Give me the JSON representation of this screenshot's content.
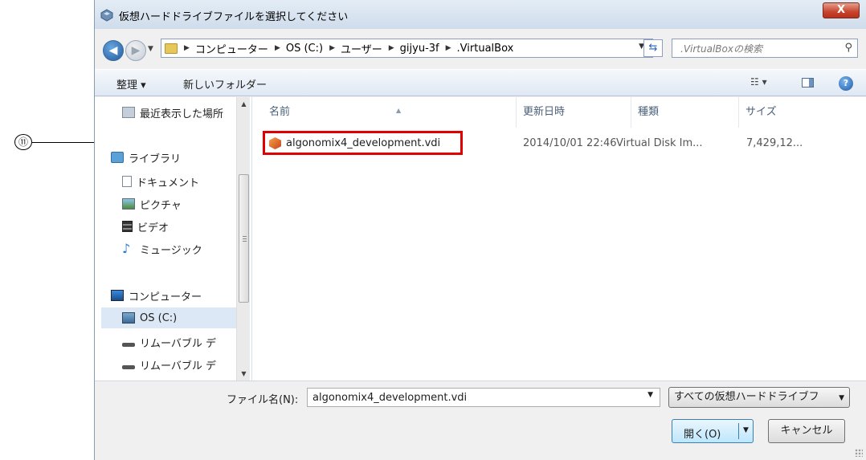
{
  "annotation": {
    "marker": "⑪"
  },
  "window": {
    "title": "仮想ハードドライブファイルを選択してください",
    "close_label": "X"
  },
  "address": {
    "crumbs": [
      "コンピューター",
      "OS (C:)",
      "ユーザー",
      "gijyu-3f",
      ".VirtualBox"
    ],
    "search_placeholder": ".VirtualBoxの検索"
  },
  "toolbar": {
    "organize_label": "整理 ▾",
    "new_folder_label": "新しいフォルダー",
    "help_label": "?"
  },
  "nav": {
    "items": [
      {
        "label": "最近表示した場所",
        "icon": "recent-places-icon"
      },
      {
        "label": "ライブラリ",
        "icon": "library-icon"
      },
      {
        "label": "ドキュメント",
        "icon": "document-icon"
      },
      {
        "label": "ピクチャ",
        "icon": "pictures-icon"
      },
      {
        "label": "ビデオ",
        "icon": "video-icon"
      },
      {
        "label": "ミュージック",
        "icon": "music-icon"
      },
      {
        "label": "コンピューター",
        "icon": "computer-icon"
      },
      {
        "label": "OS (C:)",
        "icon": "drive-icon"
      },
      {
        "label": "リムーバブル デ",
        "icon": "removable-drive-icon"
      },
      {
        "label": "リムーバブル デ",
        "icon": "removable-drive-icon"
      }
    ]
  },
  "files": {
    "columns": [
      "名前",
      "更新日時",
      "種類",
      "サイズ"
    ],
    "rows": [
      {
        "name": "algonomix4_development.vdi",
        "modified": "2014/10/01 22:46",
        "type": "Virtual Disk Im...",
        "size": "7,429,12..."
      }
    ]
  },
  "bottom": {
    "filename_label": "ファイル名(N):",
    "filename_value": "algonomix4_development.vdi",
    "filetype_value": "すべての仮想ハードドライブフ",
    "open_label": "開く(O)",
    "cancel_label": "キャンセル"
  },
  "colors": {
    "highlight": "#e00000",
    "accent": "#3c7fb1"
  }
}
